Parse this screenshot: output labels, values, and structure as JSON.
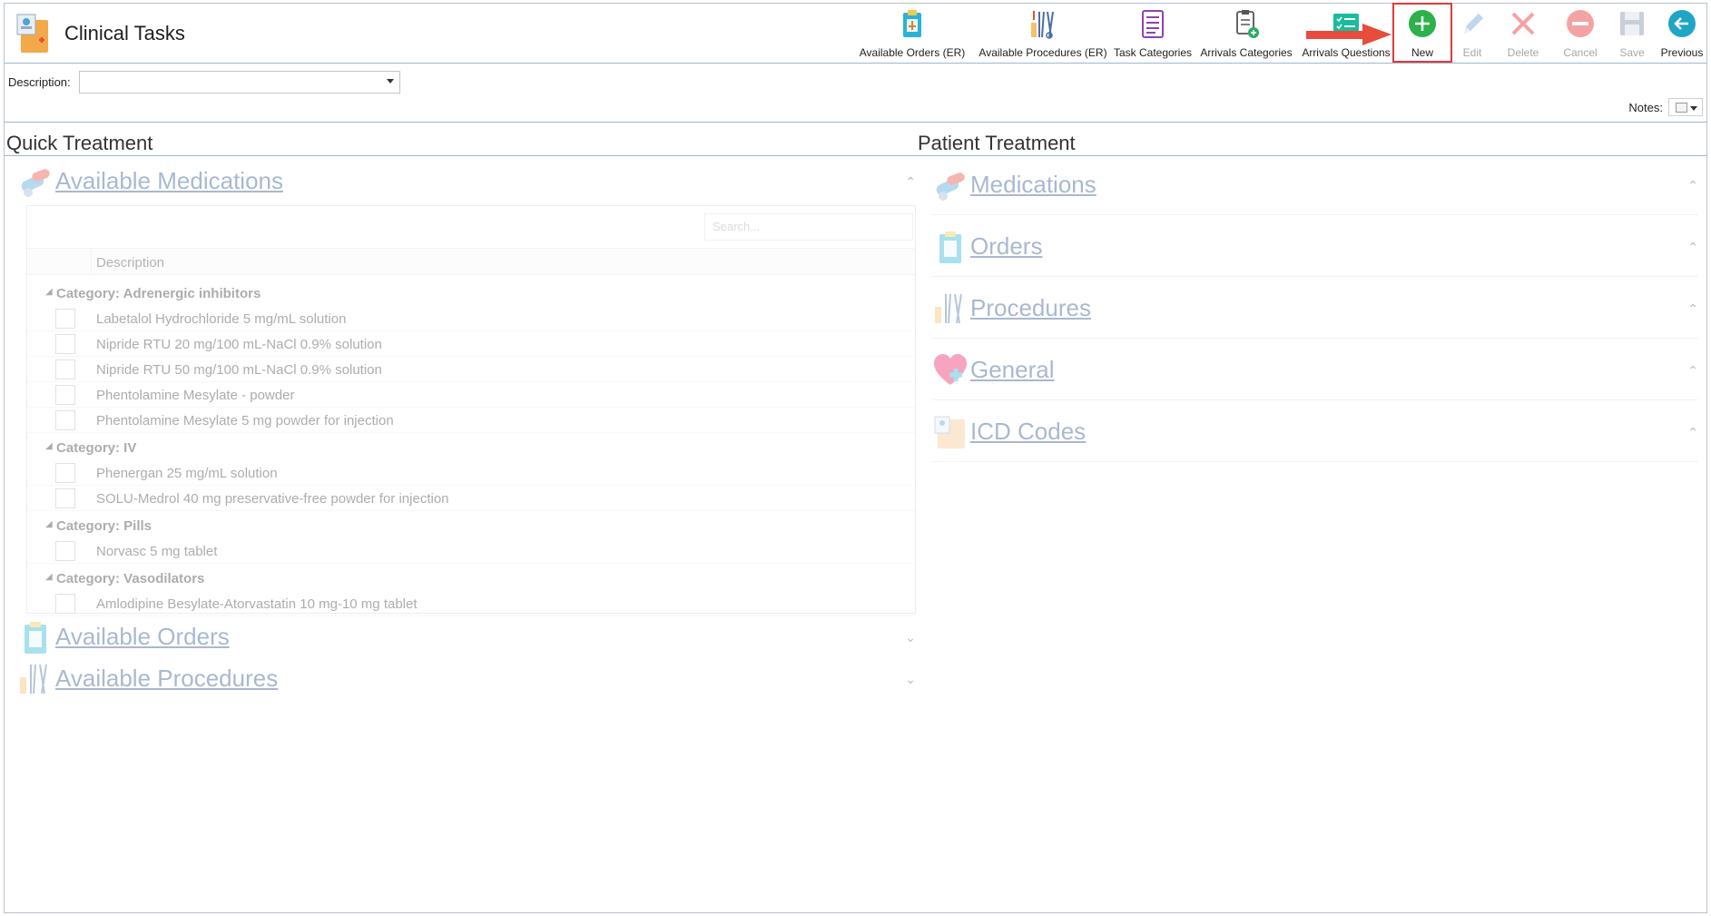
{
  "app": {
    "title": "Clinical Tasks"
  },
  "toolbar": {
    "available_orders": "Available Orders (ER)",
    "available_procedures": "Available Procedures (ER)",
    "task_categories": "Task Categories",
    "arrivals_categories": "Arrivals Categories",
    "arrivals_questions": "Arrivals Questions",
    "new": "New",
    "edit": "Edit",
    "delete": "Delete",
    "cancel": "Cancel",
    "save": "Save",
    "previous": "Previous"
  },
  "form": {
    "description_label": "Description:",
    "description_value": "",
    "notes_label": "Notes:"
  },
  "quick_treatment": {
    "heading": "Quick Treatment",
    "available_medications": {
      "title": "Available Medications",
      "search_placeholder": "Search...",
      "column_header": "Description",
      "categories": [
        {
          "label": "Category: Adrenergic inhibitors",
          "items": [
            "Labetalol Hydrochloride 5 mg/mL solution",
            "Nipride RTU 20 mg/100 mL-NaCl 0.9% solution",
            "Nipride RTU 50 mg/100 mL-NaCl 0.9% solution",
            "Phentolamine Mesylate - powder",
            "Phentolamine Mesylate 5 mg powder for injection"
          ]
        },
        {
          "label": "Category: IV",
          "items": [
            "Phenergan 25 mg/mL solution",
            "SOLU-Medrol 40 mg preservative-free powder for injection"
          ]
        },
        {
          "label": "Category: Pills",
          "items": [
            "Norvasc 5 mg tablet"
          ]
        },
        {
          "label": "Category: Vasodilators",
          "items": [
            "Amlodipine Besylate-Atorvastatin 10 mg-10 mg tablet"
          ]
        }
      ]
    },
    "available_orders": {
      "title": "Available Orders"
    },
    "available_procedures": {
      "title": "Available Procedures"
    }
  },
  "patient_treatment": {
    "heading": "Patient Treatment",
    "sections": {
      "medications": "Medications",
      "orders": "Orders",
      "procedures": "Procedures",
      "general": "General",
      "icd_codes": "ICD Codes"
    }
  },
  "colors": {
    "new_highlight": "#e03a3a",
    "link_blue": "#2b4f8b",
    "new_green": "#2eb04a",
    "previous_teal": "#1fa5c5"
  },
  "icons": {
    "app": "clinical-tasks-icon",
    "new": "plus-circle-icon",
    "edit": "pencil-icon",
    "delete": "x-icon",
    "cancel": "minus-circle-icon",
    "save": "floppy-disk-icon",
    "previous": "arrow-left-circle-icon"
  }
}
